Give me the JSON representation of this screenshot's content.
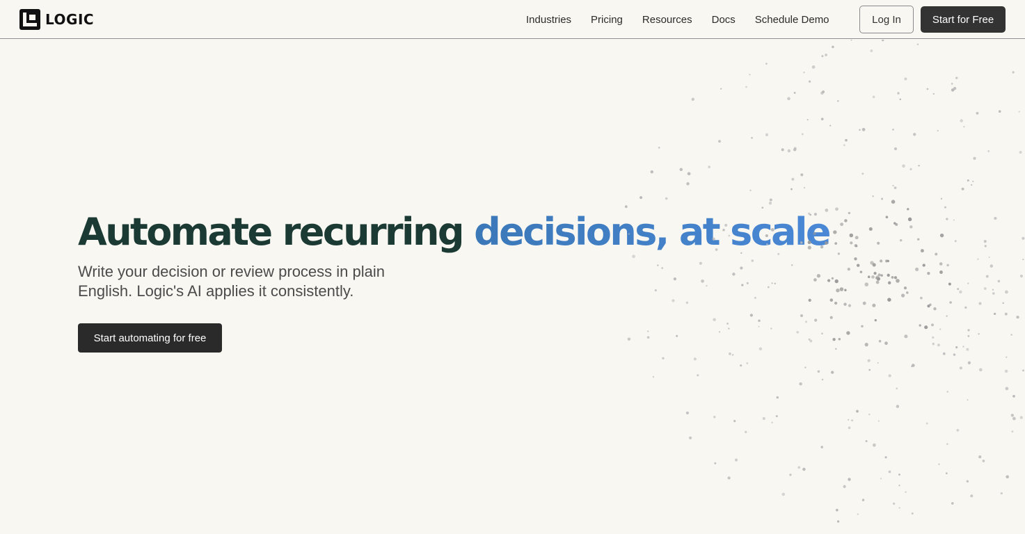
{
  "header": {
    "logo_text": "LOGIC",
    "nav": [
      {
        "label": "Industries"
      },
      {
        "label": "Pricing"
      },
      {
        "label": "Resources"
      },
      {
        "label": "Docs"
      },
      {
        "label": "Schedule Demo"
      }
    ],
    "login_label": "Log In",
    "start_label": "Start for Free"
  },
  "hero": {
    "title_part1": "Automate recurring",
    "title_part2": "decisions, at scale",
    "subtitle": "Write your decision or review process in plain English. Logic's AI applies it consistently.",
    "cta_label": "Start automating for free"
  },
  "colors": {
    "background": "#f9f7f2",
    "title_dark": "#1c3a34",
    "title_blue": "#3b78b8",
    "button_dark": "#333333"
  }
}
